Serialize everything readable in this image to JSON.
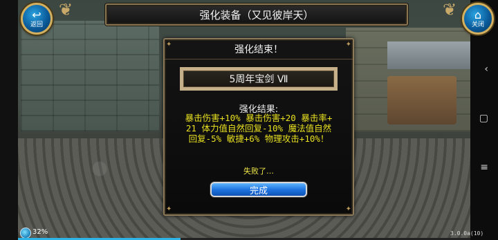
{
  "header": {
    "title": "强化装备（又见彼岸天）",
    "back_label": "返回",
    "close_label": "关闭"
  },
  "dialog": {
    "title": "强化结束！",
    "item_name": "5周年宝剑 Ⅶ",
    "result_label": "强化结果:",
    "result_lines": [
      "暴击伤害+10% 暴击伤害+20 暴击率+",
      "21 体力值自然回复-10% 魔法值自然",
      "回复-5% 敏捷+6% 物理攻击+10%！"
    ],
    "fail_text": "失败了…",
    "confirm_label": "完成"
  },
  "status": {
    "network_percent": "32%",
    "version": "3.0.0a(10)",
    "progress": 0.36
  },
  "android_nav": {
    "back": "‹",
    "home": "▢",
    "menu": "≡"
  },
  "colors": {
    "result_text": "#e8e020",
    "button_blue": "#1f74e0",
    "frame_gold": "#8c7a58"
  }
}
